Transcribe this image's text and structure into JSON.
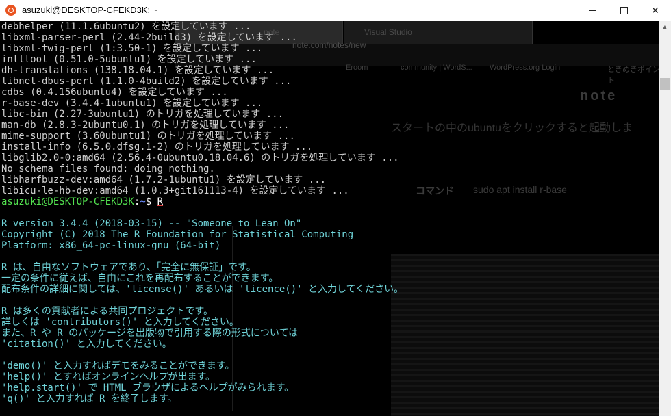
{
  "window": {
    "title": "asuzuki@DESKTOP-CFEKD3K: ~",
    "controls": {
      "minimize": "—",
      "maximize": "☐",
      "close": "✕"
    }
  },
  "background_browser": {
    "tabs": [
      "note",
      "Visual Studio"
    ],
    "url": "note.com/notes/new",
    "bookmarks": [
      "Eroom",
      "community | WordS...",
      "WordPress.org Login",
      "ときめきポイント"
    ],
    "page_logo": "note",
    "heading": "スタートの中のubuntuをクリックすると起動しま",
    "command_label": "コマンド",
    "command": "sudo apt install r-base"
  },
  "terminal": {
    "install_lines": [
      "debhelper (11.1.6ubuntu2) を設定しています ...",
      "libxml-parser-perl (2.44-2build3) を設定しています ...",
      "libxml-twig-perl (1:3.50-1) を設定しています ...",
      "intltool (0.51.0-5ubuntu1) を設定しています ...",
      "dh-translations (138.18.04.1) を設定しています ...",
      "libnet-dbus-perl (1.1.0-4build2) を設定しています ...",
      "cdbs (0.4.156ubuntu4) を設定しています ...",
      "r-base-dev (3.4.4-1ubuntu1) を設定しています ...",
      "libc-bin (2.27-3ubuntu1) のトリガを処理しています ...",
      "man-db (2.8.3-2ubuntu0.1) のトリガを処理しています ...",
      "mime-support (3.60ubuntu1) のトリガを処理しています ...",
      "install-info (6.5.0.dfsg.1-2) のトリガを処理しています ...",
      "libglib2.0-0:amd64 (2.56.4-0ubuntu0.18.04.6) のトリガを処理しています ...",
      "No schema files found: doing nothing.",
      "libharfbuzz-dev:amd64 (1.7.2-1ubuntu1) を設定しています ...",
      "libicu-le-hb-dev:amd64 (1.0.3+git161113-4) を設定しています ..."
    ],
    "prompt": {
      "user_host": "asuzuki@DESKTOP-CFEKD3K",
      "separator": ":",
      "path": "~",
      "symbol": "$",
      "command": "R"
    },
    "r_banner": [
      "R version 3.4.4 (2018-03-15) -- \"Someone to Lean On\"",
      "Copyright (C) 2018 The R Foundation for Statistical Computing",
      "Platform: x86_64-pc-linux-gnu (64-bit)",
      "",
      "R は、自由なソフトウェアであり、「完全に無保証」です。",
      "一定の条件に従えば、自由にこれを再配布することができます。",
      "配布条件の詳細に関しては、'license()' あるいは 'licence()' と入力してください。",
      "",
      "R は多くの貢献者による共同プロジェクトです。",
      "詳しくは 'contributors()' と入力してください。",
      "また、R や R のパッケージを出版物で引用する際の形式については",
      "'citation()' と入力してください。",
      "",
      "'demo()' と入力すればデモをみることができます。",
      "'help()' とすればオンラインヘルプが出ます。",
      "'help.start()' で HTML ブラウザによるヘルプがみられます。",
      "'q()' と入力すれば R を終了します。"
    ]
  },
  "colors": {
    "terminal_text": "#cfcfcf",
    "r_text": "#6fd3d8",
    "prompt_user": "#52e04f",
    "prompt_path": "#6b8cff",
    "ubuntu_orange": "#e95420"
  },
  "scrollbar": {
    "up_arrow": "▲"
  }
}
